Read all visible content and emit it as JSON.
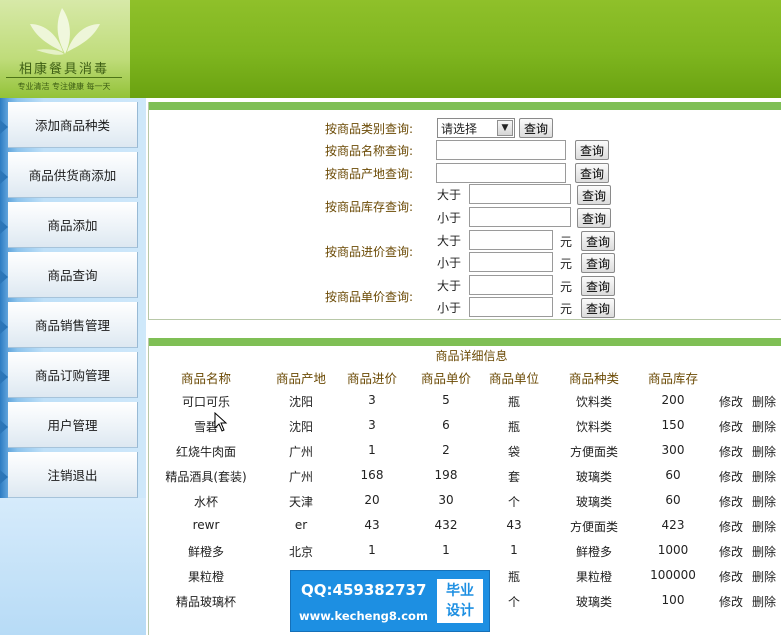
{
  "header": {
    "logo_name": "相康餐具消毒",
    "logo_slogan": "专业清洁 专注健康 每一天"
  },
  "sidebar": {
    "items": [
      {
        "label": "添加商品种类"
      },
      {
        "label": "商品供货商添加"
      },
      {
        "label": "商品添加"
      },
      {
        "label": "商品查询"
      },
      {
        "label": "商品销售管理"
      },
      {
        "label": "商品订购管理"
      },
      {
        "label": "用户管理"
      },
      {
        "label": "注销退出"
      }
    ]
  },
  "search": {
    "category_label": "按商品类别查询:",
    "category_selected": "请选择",
    "name_label": "按商品名称查询:",
    "origin_label": "按商品产地查询:",
    "stock_label": "按商品库存查询:",
    "purchase_label": "按商品进价查询:",
    "price_label": "按商品单价查询:",
    "greater_than": "大于",
    "less_than": "小于",
    "unit_yuan": "元",
    "query_button": "查询"
  },
  "table": {
    "title": "商品详细信息",
    "columns": [
      "商品名称",
      "商品产地",
      "商品进价",
      "商品单价",
      "商品单位",
      "商品种类",
      "商品库存"
    ],
    "edit_label": "修改",
    "delete_label": "删除",
    "rows": [
      [
        "可口可乐",
        "沈阳",
        "3",
        "5",
        "瓶",
        "饮料类",
        "200"
      ],
      [
        "雪碧",
        "沈阳",
        "3",
        "6",
        "瓶",
        "饮料类",
        "150"
      ],
      [
        "红烧牛肉面",
        "广州",
        "1",
        "2",
        "袋",
        "方便面类",
        "300"
      ],
      [
        "精品酒具(套装)",
        "广州",
        "168",
        "198",
        "套",
        "玻璃类",
        "60"
      ],
      [
        "水杯",
        "天津",
        "20",
        "30",
        "个",
        "玻璃类",
        "60"
      ],
      [
        "rewr",
        "er",
        "43",
        "432",
        "43",
        "方便面类",
        "423"
      ],
      [
        "鲜橙多",
        "北京",
        "1",
        "1",
        "1",
        "鲜橙多",
        "1000"
      ],
      [
        "果粒橙",
        "",
        "",
        "",
        "瓶",
        "果粒橙",
        "100000"
      ],
      [
        "精品玻璃杯",
        "",
        "",
        "",
        "个",
        "玻璃类",
        "100"
      ]
    ]
  },
  "watermark": {
    "qq": "QQ:459382737",
    "url": "www.kecheng8.com",
    "badge_line1": "毕业",
    "badge_line2": "设计"
  },
  "colors": {
    "header_green": "#7eb51f",
    "panel_bar_green": "#7fbf55",
    "label_brown": "#6b4a05",
    "sidebar_blue": "#8cc3ec",
    "watermark_blue": "#1d8fe2"
  }
}
